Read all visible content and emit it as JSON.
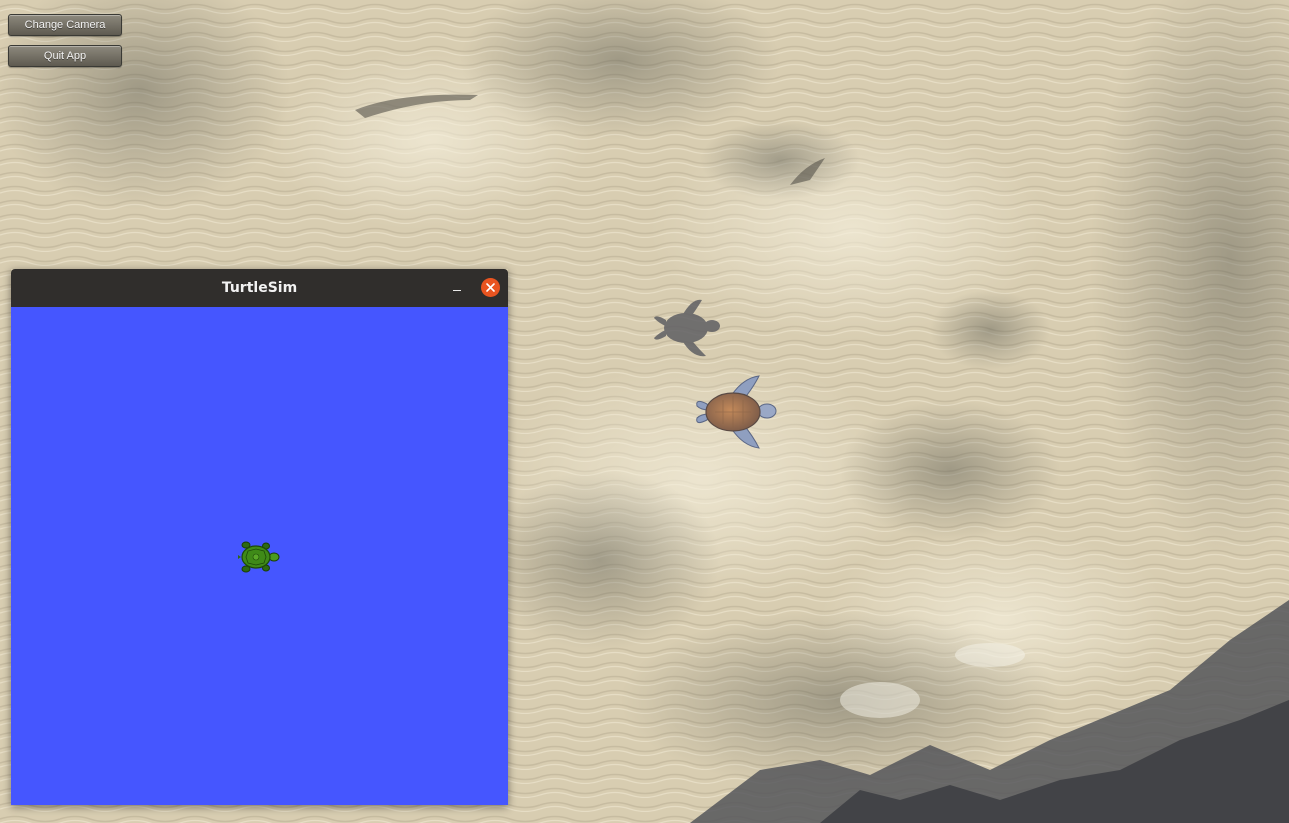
{
  "game": {
    "buttons": {
      "change_camera": "Change Camera",
      "quit_app": "Quit App"
    },
    "scene": {
      "ground": "rippled sand seabed",
      "turtle_icon": "sea-turtle-icon",
      "shadow_icon": "turtle-shadow-icon"
    }
  },
  "turtlesim": {
    "title": "TurtleSim",
    "minimize_icon": "minimize-icon",
    "close_icon": "close-icon",
    "canvas_color": "#4556ff",
    "turtle_icon": "turtle-icon"
  },
  "colors": {
    "titlebar": "#302e2c",
    "close_button": "#e95420",
    "sand": "#d9cfb5"
  }
}
